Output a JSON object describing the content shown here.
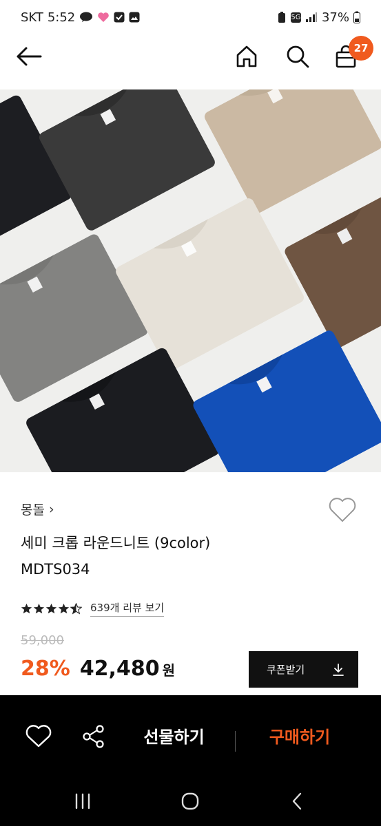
{
  "status_bar": {
    "carrier": "SKT",
    "time": "5:52",
    "network": "5G",
    "battery": "37%"
  },
  "header": {
    "cart_count": "27",
    "icons": [
      "back-arrow-icon",
      "home-icon",
      "search-icon",
      "cart-icon"
    ]
  },
  "product": {
    "brand": "몽돌",
    "brand_chevron": "›",
    "title": "세미 크롭 라운드니트 (9color)",
    "code": "MDTS034",
    "rating": 4.5,
    "review_link": "639개 리뷰 보기",
    "original_price": "59,000",
    "discount": "28%",
    "sale_price": "42,480",
    "currency": "원",
    "coupon_label": "쿠폰받기"
  },
  "purchase_bar": {
    "gift_label": "선물하기",
    "buy_label": "구매하기"
  },
  "colors": {
    "accent": "#f05a1e",
    "bar_bg": "#000000"
  }
}
